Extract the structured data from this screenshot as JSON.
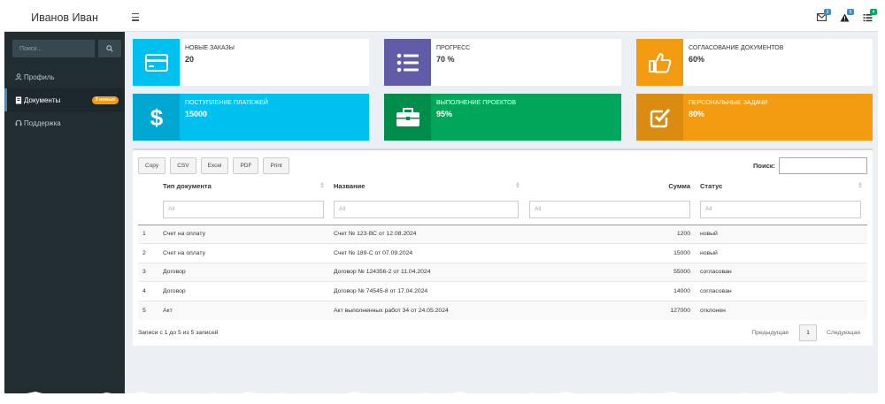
{
  "app": {
    "user_name": "Иванов Иван"
  },
  "sidebar": {
    "search_placeholder": "Поиск...",
    "items": [
      {
        "label": "Профиль",
        "icon": "user-icon"
      },
      {
        "label": "Документы",
        "icon": "document-icon",
        "badge": "3 новых"
      },
      {
        "label": "Поддержка",
        "icon": "headset-icon"
      }
    ]
  },
  "header": {
    "notifications": [
      {
        "icon": "envelope-icon",
        "count": "3",
        "color": "#3c8dbc"
      },
      {
        "icon": "warning-icon",
        "count": "5",
        "color": "#3c8dbc"
      },
      {
        "icon": "tasks-icon",
        "count": "4",
        "color": "#00a65a"
      }
    ]
  },
  "stats": [
    {
      "label": "Новые заказы",
      "value": "20",
      "icon": "credit-card-icon",
      "color": "#00c0ef",
      "style": "light"
    },
    {
      "label": "Прогресс",
      "value": "70 %",
      "icon": "list-icon",
      "color": "#605ca8",
      "style": "light"
    },
    {
      "label": "Согласование документов",
      "value": "60%",
      "icon": "thumbs-up-icon",
      "color": "#f39c12",
      "style": "light"
    },
    {
      "label": "Поступление платежей",
      "value": "15000",
      "icon": "dollar-icon",
      "color": "#00c0ef",
      "style": "filled"
    },
    {
      "label": "Выполнение проектов",
      "value": "95%",
      "icon": "briefcase-icon",
      "color": "#00a65a",
      "style": "filled"
    },
    {
      "label": "Персональные задачи",
      "value": "80%",
      "icon": "check-square-icon",
      "color": "#f39c12",
      "style": "filled"
    }
  ],
  "table": {
    "export_buttons": [
      "Copy",
      "CSV",
      "Excel",
      "PDF",
      "Print"
    ],
    "search_label": "Поиск:",
    "columns": [
      "",
      "Тип документа",
      "Название",
      "Сумма",
      "Статус"
    ],
    "filter_placeholder": "All",
    "rows": [
      [
        "1",
        "Счет на оплату",
        "Счет № 123-ВС от 12.08.2024",
        "1200",
        "новый"
      ],
      [
        "2",
        "Счет на оплату",
        "Счет № 189-С от 07.09.2024",
        "15000",
        "новый"
      ],
      [
        "3",
        "Договор",
        "Договор № 124356-2 от 11.04.2024",
        "55000",
        "согласован"
      ],
      [
        "4",
        "Договор",
        "Договор № 74545-8 от 17.04.2024",
        "14000",
        "согласован"
      ],
      [
        "5",
        "Акт",
        "Акт выполненных работ 34 от 24.05.2024",
        "127000",
        "отклонен"
      ]
    ],
    "info": "Записи с 1 до 5 из 5 записей",
    "pager": {
      "prev": "Предыдущая",
      "page": "1",
      "next": "Следующая"
    }
  }
}
